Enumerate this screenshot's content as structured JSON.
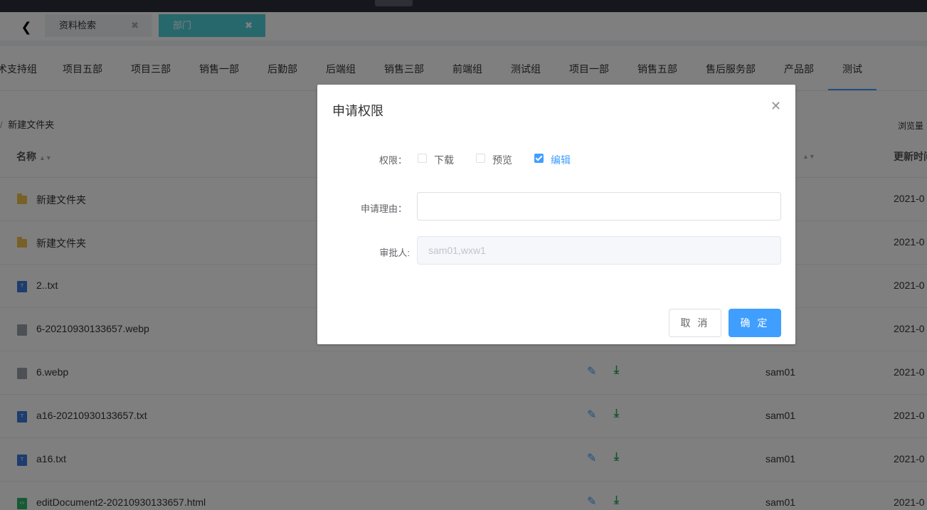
{
  "tabbar": {
    "tabs": [
      {
        "label": "资料检索",
        "close": "✖"
      },
      {
        "label": "部门",
        "close": "✖"
      }
    ]
  },
  "departments": [
    "术支持组",
    "项目五部",
    "项目三部",
    "销售一部",
    "后勤部",
    "后端组",
    "销售三部",
    "前端组",
    "测试组",
    "项目一部",
    "销售五部",
    "售后服务部",
    "产品部",
    "测试"
  ],
  "toolbar": {
    "new_folder": "新建文件夹",
    "views": "浏览量"
  },
  "table": {
    "headers": {
      "name": "名称",
      "updated": "更新时间"
    },
    "rows": [
      {
        "type": "folder",
        "name": "新建文件夹",
        "owner": "",
        "date": "2021-0"
      },
      {
        "type": "folder",
        "name": "新建文件夹",
        "owner": "",
        "date": "2021-0"
      },
      {
        "type": "txt",
        "name": "2..txt",
        "owner": "",
        "date": "2021-0"
      },
      {
        "type": "img",
        "name": "6-20210930133657.webp",
        "owner": "",
        "date": "2021-0"
      },
      {
        "type": "img",
        "name": "6.webp",
        "owner": "sam01",
        "date": "2021-0"
      },
      {
        "type": "txt",
        "name": "a16-20210930133657.txt",
        "owner": "sam01",
        "date": "2021-0"
      },
      {
        "type": "txt",
        "name": "a16.txt",
        "owner": "sam01",
        "date": "2021-0"
      },
      {
        "type": "html",
        "name": "editDocument2-20210930133657.html",
        "owner": "sam01",
        "date": "2021-0"
      }
    ]
  },
  "dialog": {
    "title": "申请权限",
    "permission_label": "权限：",
    "options": [
      {
        "label": "下载",
        "checked": false
      },
      {
        "label": "预览",
        "checked": false
      },
      {
        "label": "编辑",
        "checked": true
      }
    ],
    "reason_label": "申请理由：",
    "reason_value": "",
    "approver_label": "审批人:",
    "approver_value": "sam01,wxw1",
    "cancel": "取 消",
    "confirm": "确 定"
  },
  "colors": {
    "primary": "#409eff",
    "tab_active": "#4fd0db",
    "download": "#26a65b",
    "folder": "#f0c24f"
  }
}
